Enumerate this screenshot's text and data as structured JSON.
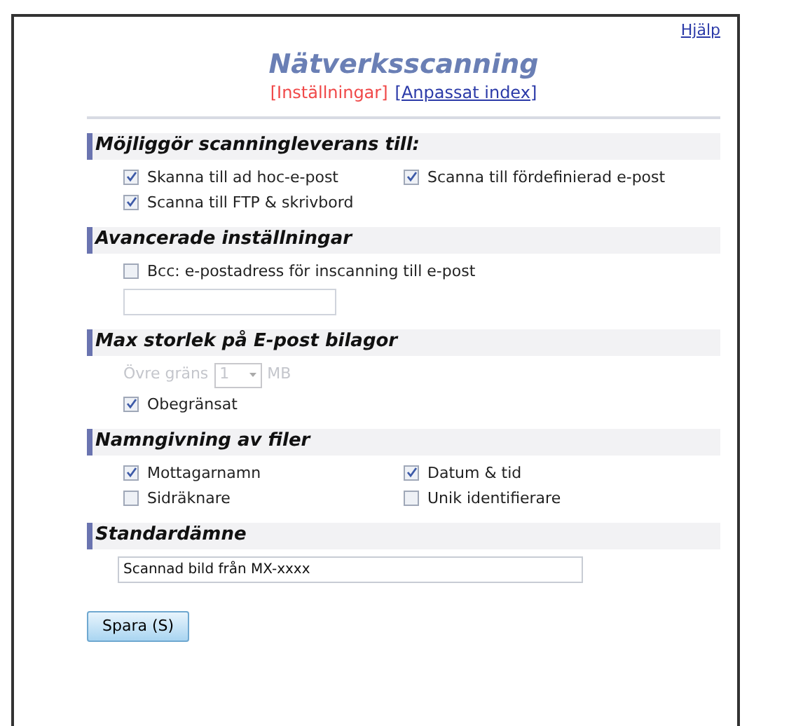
{
  "help_link": "Hjälp",
  "title": "Nätverksscanning",
  "nav": [
    {
      "label": "[Inställningar]",
      "selected": true
    },
    {
      "label": "[Anpassat index]",
      "selected": false
    }
  ],
  "sections": [
    {
      "title": "Möjliggör scanningleverans till:",
      "kind": "checkboxes",
      "options": [
        {
          "label": "Skanna till ad hoc-e-post",
          "checked": true
        },
        {
          "label": "Scanna till fördefinierad e-post",
          "checked": true
        },
        {
          "label": "Scanna till FTP & skrivbord",
          "checked": true
        }
      ]
    },
    {
      "title": "Avancerade inställningar",
      "kind": "bcc",
      "option": {
        "label": "Bcc: e-postadress för inscanning till e-post",
        "checked": false
      }
    },
    {
      "title": "Max storlek på E-post bilagor",
      "kind": "size",
      "limit": {
        "label": "Övre gräns",
        "value": "1",
        "unit": "MB",
        "disabled": true
      },
      "option": {
        "label": "Obegränsat",
        "checked": true
      }
    },
    {
      "title": "Namngivning av filer",
      "kind": "checkboxes",
      "options": [
        {
          "label": "Mottagarnamn",
          "checked": true
        },
        {
          "label": "Datum & tid",
          "checked": true
        },
        {
          "label": "Sidräknare",
          "checked": false
        },
        {
          "label": "Unik identifierare",
          "checked": false
        }
      ]
    },
    {
      "title": "Standardämne",
      "kind": "text",
      "field": {
        "value": "Scannad bild från MX-xxxx"
      }
    }
  ],
  "save_button": "Spara (S)"
}
